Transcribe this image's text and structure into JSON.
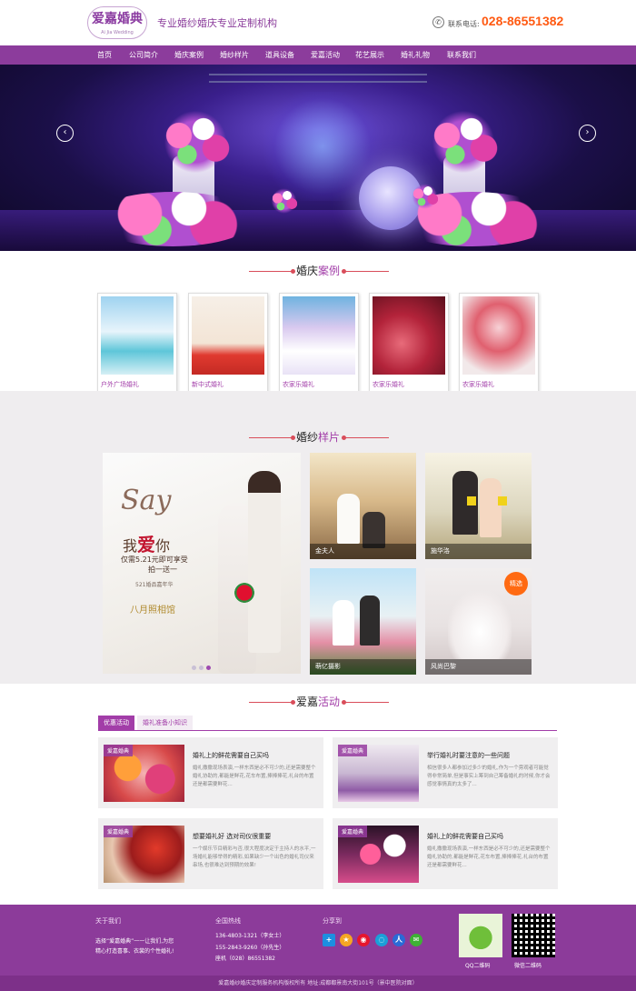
{
  "header": {
    "logo_main": "爱嘉婚典",
    "logo_sub": "Ai Jia Wedding",
    "slogan": "专业婚纱婚庆专业定制机构",
    "phone_label": "联系电话:",
    "phone_number": "028-86551382"
  },
  "nav": [
    "首页",
    "公司简介",
    "婚庆案例",
    "婚纱样片",
    "道具设备",
    "爱嘉活动",
    "花艺展示",
    "婚礼礼物",
    "联系我们"
  ],
  "banner": {
    "prev": "‹",
    "next": "›"
  },
  "cases": {
    "title_a": "婚庆",
    "title_b": "案例",
    "items": [
      "户外广场婚礼",
      "新中式婚礼",
      "农家乐婚礼",
      "农家乐婚礼",
      "农家乐婚礼"
    ]
  },
  "gallery": {
    "title_a": "婚纱",
    "title_b": "样片",
    "promo": {
      "say": "Say",
      "love_pre": "我",
      "love_hl": "爱",
      "love_post": "你",
      "offer_1": "仅需5.21元即可享受",
      "offer_2": "拍一送一",
      "sub": "521婚品嘉年华",
      "brand": "八月照相馆"
    },
    "thumbs": [
      "金夫人",
      "施华洛",
      "萌亿摄影",
      "风尚巴黎"
    ],
    "badge": "精选"
  },
  "activities": {
    "title_a": "爱嘉",
    "title_b": "活动",
    "tabs": [
      "优惠活动",
      "婚礼准备小知识"
    ],
    "tag": "爱嘉婚典",
    "items": [
      {
        "title": "婚礼上的鲜花需要自己买吗",
        "desc": "婚礼撒撒现场表演,一样东西是必不可少的,还是需要整个婚礼协助的,都能是鲜花,花车布置,捧捧捧花,礼台的布置还是都需要鲜花..."
      },
      {
        "title": "举行婚礼时要注意的一些问题",
        "desc": "相信很多人都参加过多少的婚礼,作为一个旁观者可能觉得非常简单,但是事实上筹到自己筹备婚礼的时候,你才会感觉事情真的太多了..."
      },
      {
        "title": "想要婚礼好 选对司仪很重要",
        "desc": "一个娱乐节目精彩与否,很大程度决定于主持人的水平,一场婚礼能够举得的精彩,如果缺少一个出色的婚礼司仪来串场,也很难达到预期的效果!"
      },
      {
        "title": "婚礼上的鲜花需要自己买吗",
        "desc": "婚礼撒撒现场表演,一样东西是必不可少的,还是需要整个婚礼协助的,都能是鲜花,花车布置,捧捧捧花,礼台的布置还是都需要鲜花..."
      }
    ]
  },
  "footer": {
    "about_title": "关于我们",
    "about_1": "选择“爱嘉婚典”一一让我们,为您",
    "about_2": "精心打造喜事、衣裳的个性婚礼!",
    "hotline_title": "全国热线",
    "hotline_1": "136-4803-1321（李女士）",
    "hotline_2": "155-2843-9260（孙先生）",
    "hotline_3": "座机（028）86551382",
    "share_title": "分享到",
    "qr_1": "QQ二维码",
    "qr_2": "微信二维码",
    "copyright": "爱嘉婚纱婚庆定制服务机构版权所有  地址:成都都景南大街101号（景中医院对面）"
  },
  "colors": {
    "brand_purple": "#8c3c9c",
    "accent_orange": "#ff5a12",
    "title_line_red": "#d94d5a"
  }
}
